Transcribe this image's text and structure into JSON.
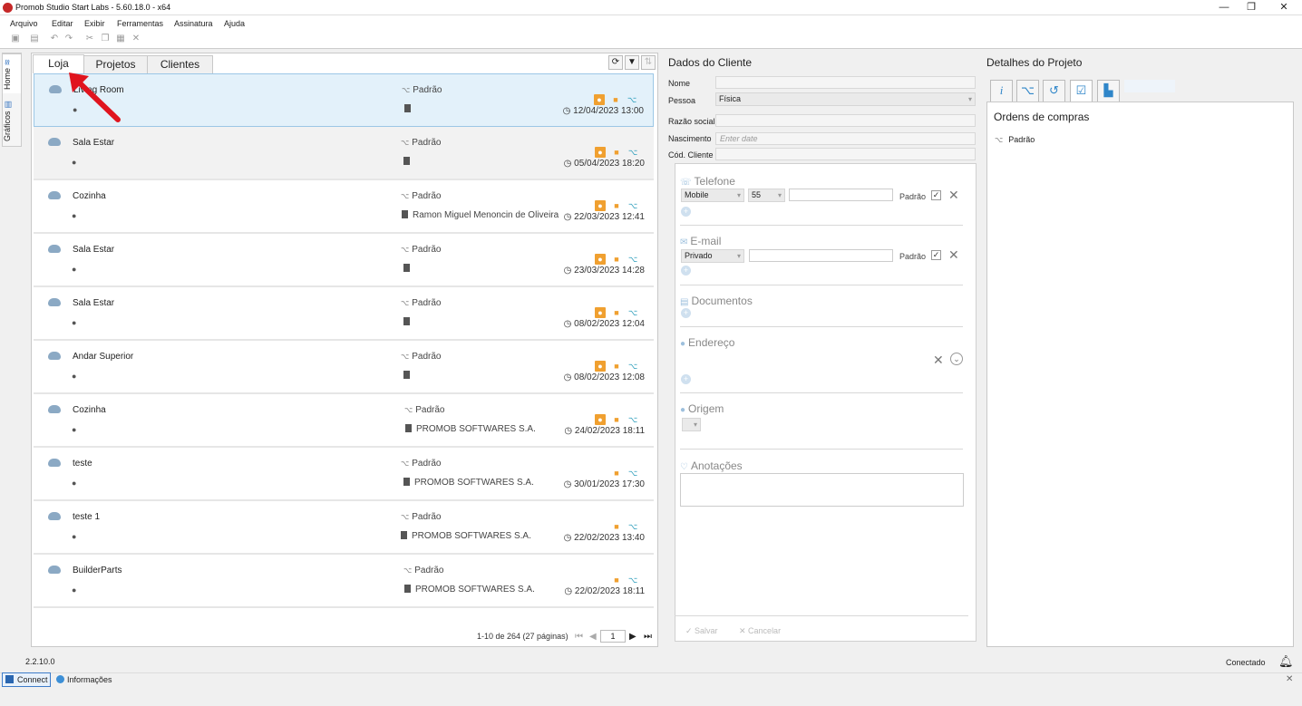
{
  "window": {
    "title": "Promob Studio Start Labs - 5.60.18.0 - x64",
    "minimize": "—",
    "restore": "❐",
    "close": "✕"
  },
  "menu": [
    "Arquivo",
    "Editar",
    "Exibir",
    "Ferramentas",
    "Assinatura",
    "Ajuda"
  ],
  "sidebar": {
    "home": "Home",
    "graficos": "Gráficos"
  },
  "tabs": [
    "Loja",
    "Projetos",
    "Clientes"
  ],
  "projects": [
    {
      "name": "Living Room",
      "version": "Padrão",
      "company": "",
      "date": "12/04/2023 13:00",
      "icons": [
        "user",
        "folder",
        "share"
      ]
    },
    {
      "name": "Sala Estar",
      "version": "Padrão",
      "company": "",
      "date": "05/04/2023 18:20",
      "icons": [
        "user",
        "folder",
        "share"
      ]
    },
    {
      "name": "Cozinha",
      "version": "Padrão",
      "company": "Ramon Miguel Menoncin de Oliveira",
      "date": "22/03/2023 12:41",
      "icons": [
        "user",
        "folder",
        "share"
      ]
    },
    {
      "name": "Sala Estar",
      "version": "Padrão",
      "company": "",
      "date": "23/03/2023 14:28",
      "icons": [
        "user",
        "folder",
        "share"
      ]
    },
    {
      "name": "Sala Estar",
      "version": "Padrão",
      "company": "",
      "date": "08/02/2023 12:04",
      "icons": [
        "user",
        "folder",
        "share"
      ]
    },
    {
      "name": "Andar Superior",
      "version": "Padrão",
      "company": "",
      "date": "08/02/2023 12:08",
      "icons": [
        "user",
        "folder",
        "share"
      ]
    },
    {
      "name": "Cozinha",
      "version": "Padrão",
      "company": "PROMOB SOFTWARES S.A.",
      "date": "24/02/2023 18:11",
      "icons": [
        "user",
        "folder",
        "share"
      ]
    },
    {
      "name": "teste",
      "version": "Padrão",
      "company": "PROMOB SOFTWARES S.A.",
      "date": "30/01/2023 17:30",
      "icons": [
        "folder",
        "share"
      ]
    },
    {
      "name": "teste 1",
      "version": "Padrão",
      "company": "PROMOB SOFTWARES S.A.",
      "date": "22/02/2023 13:40",
      "icons": [
        "folder",
        "share"
      ]
    },
    {
      "name": "BuilderParts",
      "version": "Padrão",
      "company": "PROMOB SOFTWARES S.A.",
      "date": "22/02/2023 18:11",
      "icons": [
        "folder",
        "share"
      ]
    }
  ],
  "pager": {
    "summary": "1-10 de 264 (27 páginas)",
    "page": "1"
  },
  "client": {
    "heading": "Dados do Cliente",
    "labels": {
      "nome": "Nome",
      "pessoa": "Pessoa",
      "razao": "Razão social",
      "nascimento": "Nascimento",
      "cod": "Cód. Cliente"
    },
    "pessoa_value": "Física",
    "nascimento_placeholder": "Enter date",
    "sections": {
      "telefone": "Telefone",
      "email": "E-mail",
      "documentos": "Documentos",
      "endereco": "Endereço",
      "origem": "Origem",
      "anotacoes": "Anotações"
    },
    "phone_type": "Mobile",
    "phone_code": "55",
    "email_type": "Privado",
    "padrao": "Padrão",
    "save": "Salvar",
    "cancel": "Cancelar"
  },
  "details": {
    "heading": "Detalhes do Projeto",
    "section": "Ordens de compras",
    "item": "Padrão"
  },
  "status": {
    "version": "2.2.10.0",
    "connection": "Conectado",
    "connect": "Connect",
    "info": "Informações"
  },
  "colors": {
    "accent": "#2f86c9",
    "orange": "#f0a030",
    "arrow": "#e0141e",
    "selection": "#e3f1fa"
  }
}
